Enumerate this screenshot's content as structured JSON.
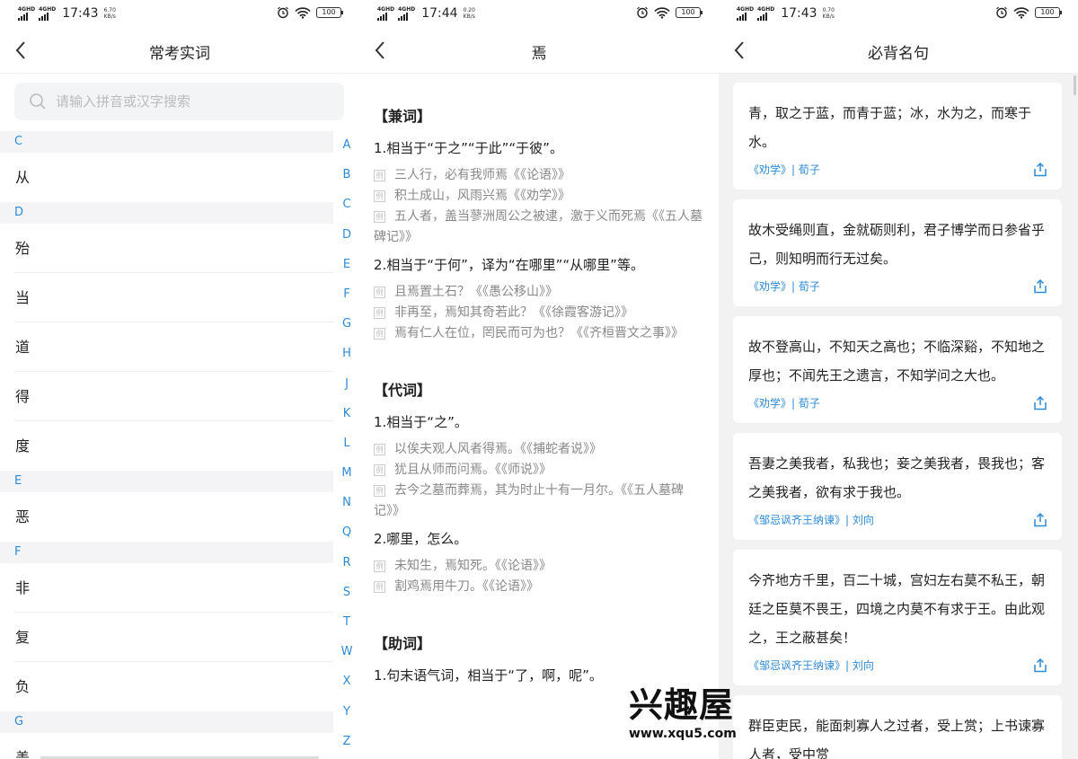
{
  "screens": [
    {
      "status": {
        "net1": "4GHD",
        "net2": "4GHD",
        "time": "17:43",
        "speed": "6.70",
        "speed_unit": "KB/s",
        "battery": "100"
      },
      "title": "常考实词",
      "search_placeholder": "请输入拼音或汉字搜索",
      "sections": [
        {
          "letter": "C",
          "words": [
            "从"
          ]
        },
        {
          "letter": "D",
          "words": [
            "殆",
            "当",
            "道",
            "得",
            "度"
          ]
        },
        {
          "letter": "E",
          "words": [
            "恶"
          ]
        },
        {
          "letter": "F",
          "words": [
            "非",
            "复",
            "负"
          ]
        },
        {
          "letter": "G",
          "words": [
            "盖"
          ]
        }
      ],
      "alphabet": [
        "A",
        "B",
        "C",
        "D",
        "E",
        "F",
        "G",
        "H",
        "J",
        "K",
        "L",
        "M",
        "N",
        "Q",
        "R",
        "S",
        "T",
        "W",
        "X",
        "Y",
        "Z"
      ]
    },
    {
      "status": {
        "net1": "4GHD",
        "net2": "4GHD",
        "time": "17:44",
        "speed": "0.20",
        "speed_unit": "KB/s",
        "battery": "100"
      },
      "title": "焉",
      "example_tag": "例",
      "categories": [
        {
          "name": "【兼词】",
          "defs": [
            {
              "text": "1.相当于“于之”“于此”“于彼”。",
              "examples": [
                "三人行，必有我师焉《《论语》》",
                "积土成山，风雨兴焉《《劝学》》",
                "五人者，盖当蓼洲周公之被逮，激于义而死焉《《五人墓碑记》》"
              ]
            },
            {
              "text": "2.相当于“于何”，译为“在哪里”“从哪里”等。",
              "examples": [
                "且焉置土石？《《愚公移山》》",
                "非再至，焉知其奇若此？《《徐霞客游记》》",
                "焉有仁人在位，罔民而可为也？《《齐桓晋文之事》》"
              ]
            }
          ]
        },
        {
          "name": "【代词】",
          "defs": [
            {
              "text": "1.相当于“之”。",
              "examples": [
                "以俟夫观人风者得焉。《《捕蛇者说》》",
                "犹且从师而问焉。《《师说》》",
                "去今之墓而葬焉，其为时止十有一月尔。《《五人墓碑记》》"
              ]
            },
            {
              "text": "2.哪里，怎么。",
              "examples": [
                "未知生，焉知死。《《论语》》",
                "割鸡焉用牛刀。《《论语》》"
              ]
            }
          ]
        },
        {
          "name": "【助词】",
          "defs": [
            {
              "text": "1.句末语气词，相当于“了，啊，呢”。",
              "examples": []
            }
          ]
        }
      ]
    },
    {
      "status": {
        "net1": "4GHD",
        "net2": "4GHD",
        "time": "17:43",
        "speed": "0.70",
        "speed_unit": "KB/s",
        "battery": "100"
      },
      "title": "必背名句",
      "quotes": [
        {
          "text": "青，取之于蓝，而青于蓝；冰，水为之，而寒于水。",
          "source": "《劝学》| 荀子"
        },
        {
          "text": "故木受绳则直，金就砺则利，君子博学而日参省乎己，则知明而行无过矣。",
          "source": "《劝学》| 荀子"
        },
        {
          "text": "故不登高山，不知天之高也；不临深谿，不知地之厚也；不闻先王之遗言，不知学问之大也。",
          "source": "《劝学》| 荀子"
        },
        {
          "text": "吾妻之美我者，私我也；妾之美我者，畏我也；客之美我者，欲有求于我也。",
          "source": "《邹忌讽齐王纳谏》| 刘向"
        },
        {
          "text": "今齐地方千里，百二十城，宫妇左右莫不私王，朝廷之臣莫不畏王，四境之内莫不有求于王。由此观之，王之蔽甚矣！",
          "source": "《邹忌讽齐王纳谏》| 刘向"
        },
        {
          "text": "群臣吏民，能面刺寡人之过者，受上赏；上书谏寡人者，受中赏",
          "source": ""
        }
      ]
    }
  ],
  "watermark": {
    "cn": "兴趣屋",
    "url": "www.xqu5.com"
  },
  "colors": {
    "accent": "#2d8ad6",
    "section_bg": "#f4f4f6",
    "cards_bg": "#f2f2f2"
  }
}
